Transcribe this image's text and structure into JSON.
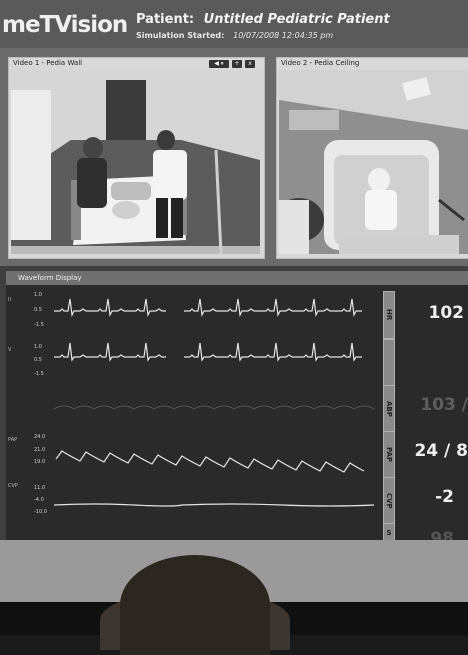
{
  "app": {
    "logo_text": "meTVision"
  },
  "header": {
    "patient_label": "Patient:",
    "patient_name": "Untitled Pediatric Patient",
    "sim_label": "Simulation Started:",
    "sim_time": "10/07/2008 12:04:35 pm"
  },
  "videos": [
    {
      "title": "Video 1 - Pedia Wall",
      "controls": [
        "◀ ⏸",
        "+",
        "x"
      ]
    },
    {
      "title": "Video 2 - Pedia Ceiling"
    }
  ],
  "waveform": {
    "title": "Waveform Display",
    "channels": [
      {
        "id": "ecg-ii",
        "lead": "II",
        "scale": [
          "1.0",
          "0.5",
          "-1.5"
        ],
        "button": "HR",
        "value": "102",
        "dim": false
      },
      {
        "id": "ecg-v",
        "lead": "V",
        "scale": [
          "1.0",
          "0.5",
          "-1.5"
        ],
        "button": "",
        "value": "",
        "dim": false
      },
      {
        "id": "abp",
        "lead": "",
        "scale": [],
        "button": "ABP",
        "value": "103 /",
        "dim": true
      },
      {
        "id": "pap",
        "lead": "PAP",
        "scale": [
          "24.0",
          "21.0",
          "19.0"
        ],
        "button": "PAP",
        "value": "24 / 8",
        "dim": false
      },
      {
        "id": "cvp",
        "lead": "CVP",
        "scale": [
          "11.0",
          "-4.0",
          "-10.0"
        ],
        "button": "CVP",
        "value": "-2",
        "dim": false
      }
    ],
    "partial_button": "S",
    "partial_value": "98"
  },
  "colors": {
    "screen_bg": "#3f3f3f",
    "trace": "#e4e4e4",
    "header_bg": "#5a5a5a"
  }
}
